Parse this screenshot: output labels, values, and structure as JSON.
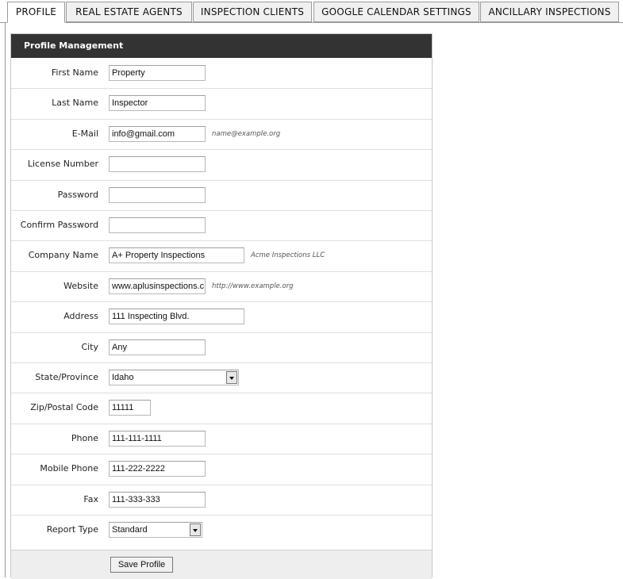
{
  "tabs": [
    {
      "label": "PROFILE",
      "active": true
    },
    {
      "label": "REAL ESTATE AGENTS",
      "active": false
    },
    {
      "label": "INSPECTION CLIENTS",
      "active": false
    },
    {
      "label": "GOOGLE CALENDAR SETTINGS",
      "active": false
    },
    {
      "label": "ANCILLARY INSPECTIONS",
      "active": false
    }
  ],
  "panel": {
    "title": "Profile Management",
    "fields": {
      "first_name": {
        "label": "First Name",
        "value": "Property"
      },
      "last_name": {
        "label": "Last Name",
        "value": "Inspector"
      },
      "email": {
        "label": "E-Mail",
        "value": "info@gmail.com",
        "hint": "name@example.org"
      },
      "license": {
        "label": "License Number",
        "value": ""
      },
      "password": {
        "label": "Password",
        "value": ""
      },
      "confirm_password": {
        "label": "Confirm Password",
        "value": ""
      },
      "company": {
        "label": "Company Name",
        "value": "A+ Property Inspections",
        "hint": "Acme Inspections LLC"
      },
      "website": {
        "label": "Website",
        "value": "www.aplusinspections.c",
        "hint": "http://www.example.org"
      },
      "address": {
        "label": "Address",
        "value": "111 Inspecting Blvd."
      },
      "city": {
        "label": "City",
        "value": "Any"
      },
      "state": {
        "label": "State/Province",
        "value": "Idaho"
      },
      "zip": {
        "label": "Zip/Postal Code",
        "value": "11111"
      },
      "phone": {
        "label": "Phone",
        "value": "111-111-1111"
      },
      "mobile": {
        "label": "Mobile Phone",
        "value": "111-222-2222"
      },
      "fax": {
        "label": "Fax",
        "value": "111-333-333"
      },
      "report_type": {
        "label": "Report Type",
        "value": "Standard"
      }
    },
    "save_label": "Save Profile"
  }
}
